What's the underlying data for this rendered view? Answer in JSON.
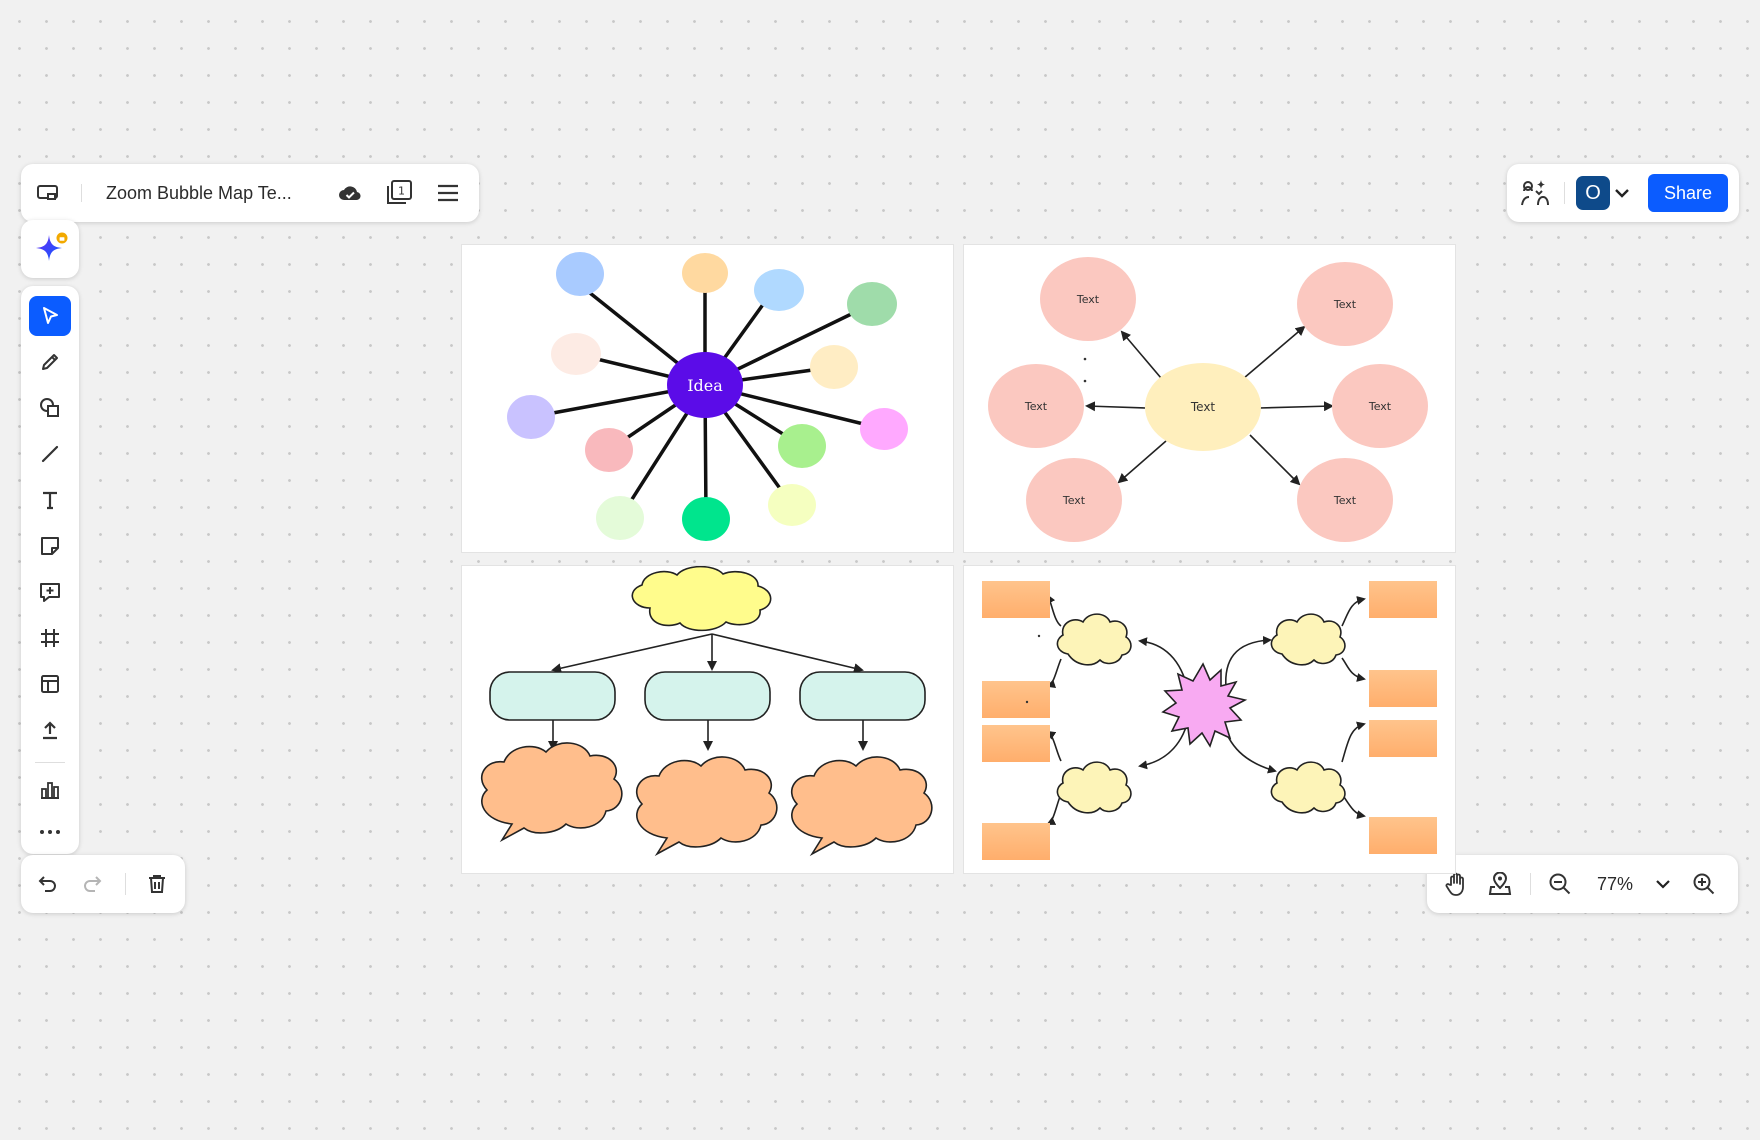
{
  "header": {
    "board_title": "Zoom Bubble Map Te..."
  },
  "share": {
    "avatar_initial": "O",
    "share_label": "Share"
  },
  "zoom": {
    "level": "77%"
  },
  "canvas": {
    "frame_bubble": {
      "center_label": "Idea"
    },
    "frame_text_map": {
      "center_label": "Text",
      "node_labels": [
        "Text",
        "Text",
        "Text",
        "Text",
        "Text",
        "Text"
      ]
    }
  },
  "colors": {
    "accent": "#0b5cff",
    "active_tool": "#0b5cff",
    "avatar_bg": "#0e4a8a",
    "idea_bubble": "#5b0ce8"
  },
  "icons": {
    "toolbar": [
      "cursor-icon",
      "pen-icon",
      "shapes-icon",
      "line-icon",
      "text-icon",
      "sticky-note-icon",
      "comment-icon",
      "frame-icon",
      "template-icon",
      "upload-icon",
      "chart-icon",
      "more-icon"
    ],
    "header": [
      "board-menu-icon",
      "cloud-saved-icon",
      "pages-icon",
      "hamburger-icon"
    ],
    "bottom_left": [
      "undo-icon",
      "redo-icon",
      "trash-icon"
    ],
    "bottom_right": [
      "hand-icon",
      "location-pin-icon",
      "zoom-out-icon",
      "chevron-down-icon",
      "zoom-in-icon"
    ]
  }
}
